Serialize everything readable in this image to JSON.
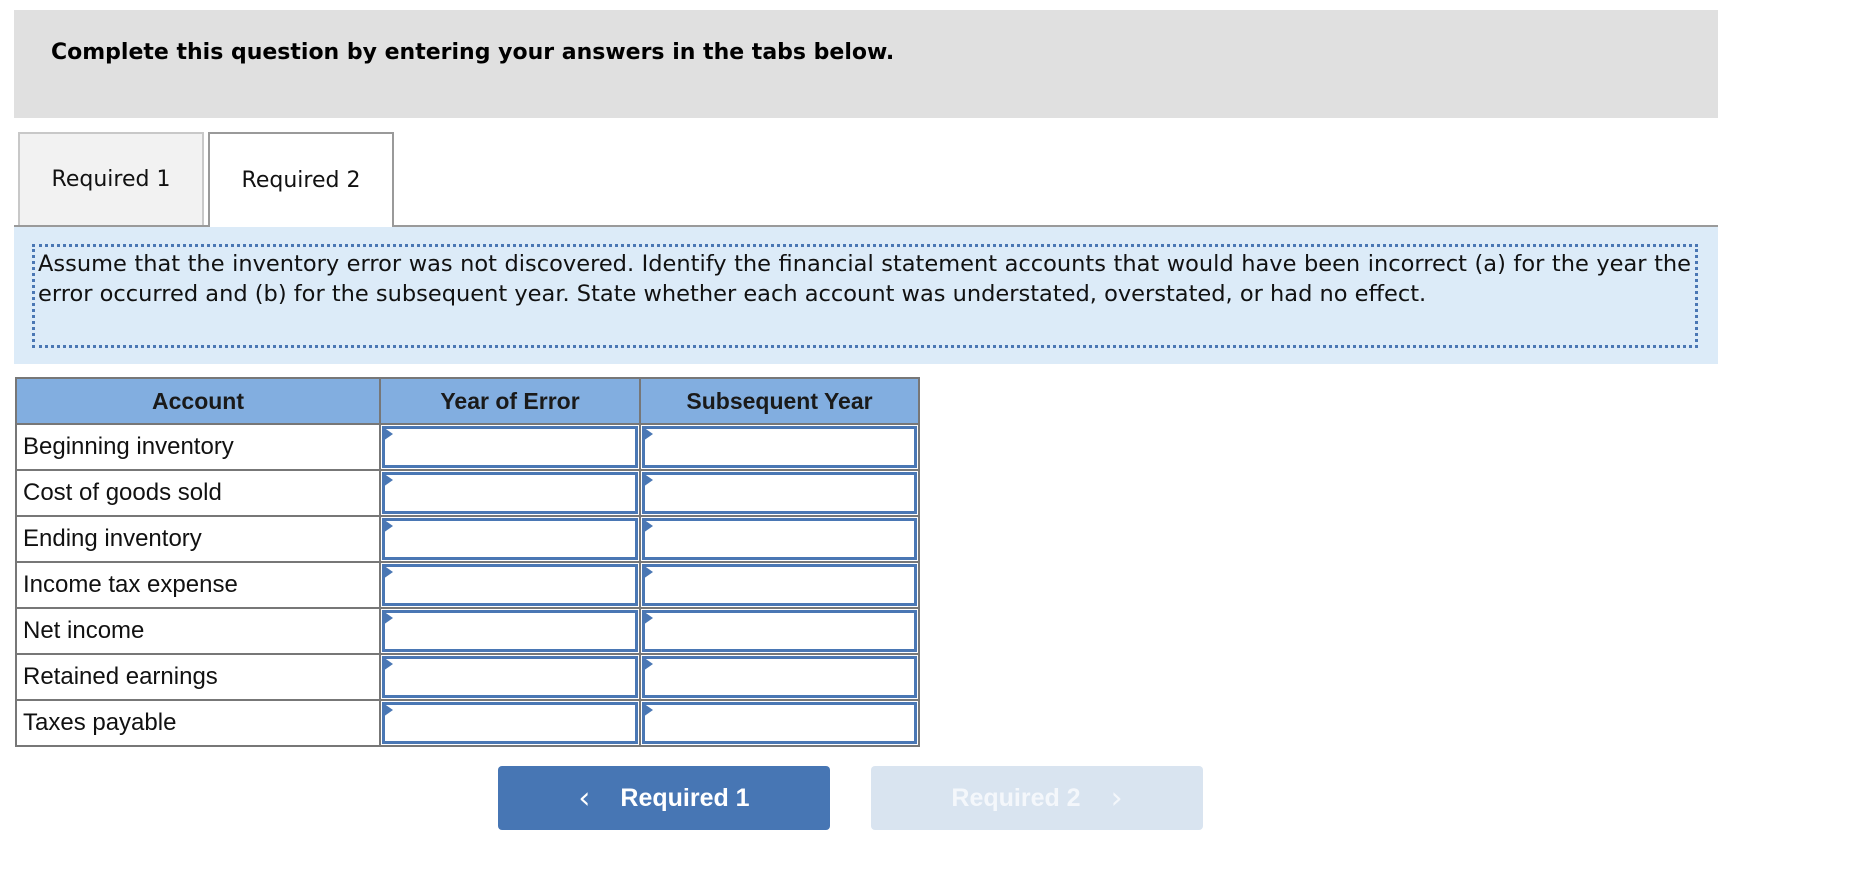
{
  "instructions": {
    "title": "Complete this question by entering your answers in the tabs below."
  },
  "tabs": [
    {
      "label": "Required 1",
      "active": false
    },
    {
      "label": "Required 2",
      "active": true
    }
  ],
  "question": {
    "text": "Assume that the inventory error was not discovered. Identify the financial statement accounts that would have been incorrect (a) for the year the error occurred and (b) for the subsequent year. State whether each account was understated, overstated, or had no effect."
  },
  "table": {
    "headers": [
      "Account",
      "Year of Error",
      "Subsequent Year"
    ],
    "rows": [
      {
        "account": "Beginning inventory",
        "year_of_error": "",
        "subsequent_year": ""
      },
      {
        "account": "Cost of goods sold",
        "year_of_error": "",
        "subsequent_year": ""
      },
      {
        "account": "Ending inventory",
        "year_of_error": "",
        "subsequent_year": ""
      },
      {
        "account": "Income tax expense",
        "year_of_error": "",
        "subsequent_year": ""
      },
      {
        "account": "Net income",
        "year_of_error": "",
        "subsequent_year": ""
      },
      {
        "account": "Retained earnings",
        "year_of_error": "",
        "subsequent_year": ""
      },
      {
        "account": "Taxes payable",
        "year_of_error": "",
        "subsequent_year": ""
      }
    ]
  },
  "navigation": {
    "prev": {
      "label": "Required 1",
      "icon": "chevron-left-icon",
      "glyph": "‹",
      "enabled": true
    },
    "next": {
      "label": "Required 2",
      "icon": "chevron-right-icon",
      "glyph": "›",
      "enabled": false
    }
  },
  "colors": {
    "header_bg": "#e0e0e0",
    "question_bg": "#dcebf8",
    "table_header_bg": "#82aee0",
    "accent": "#4776b4",
    "disabled_button": "#d9e4f0"
  }
}
